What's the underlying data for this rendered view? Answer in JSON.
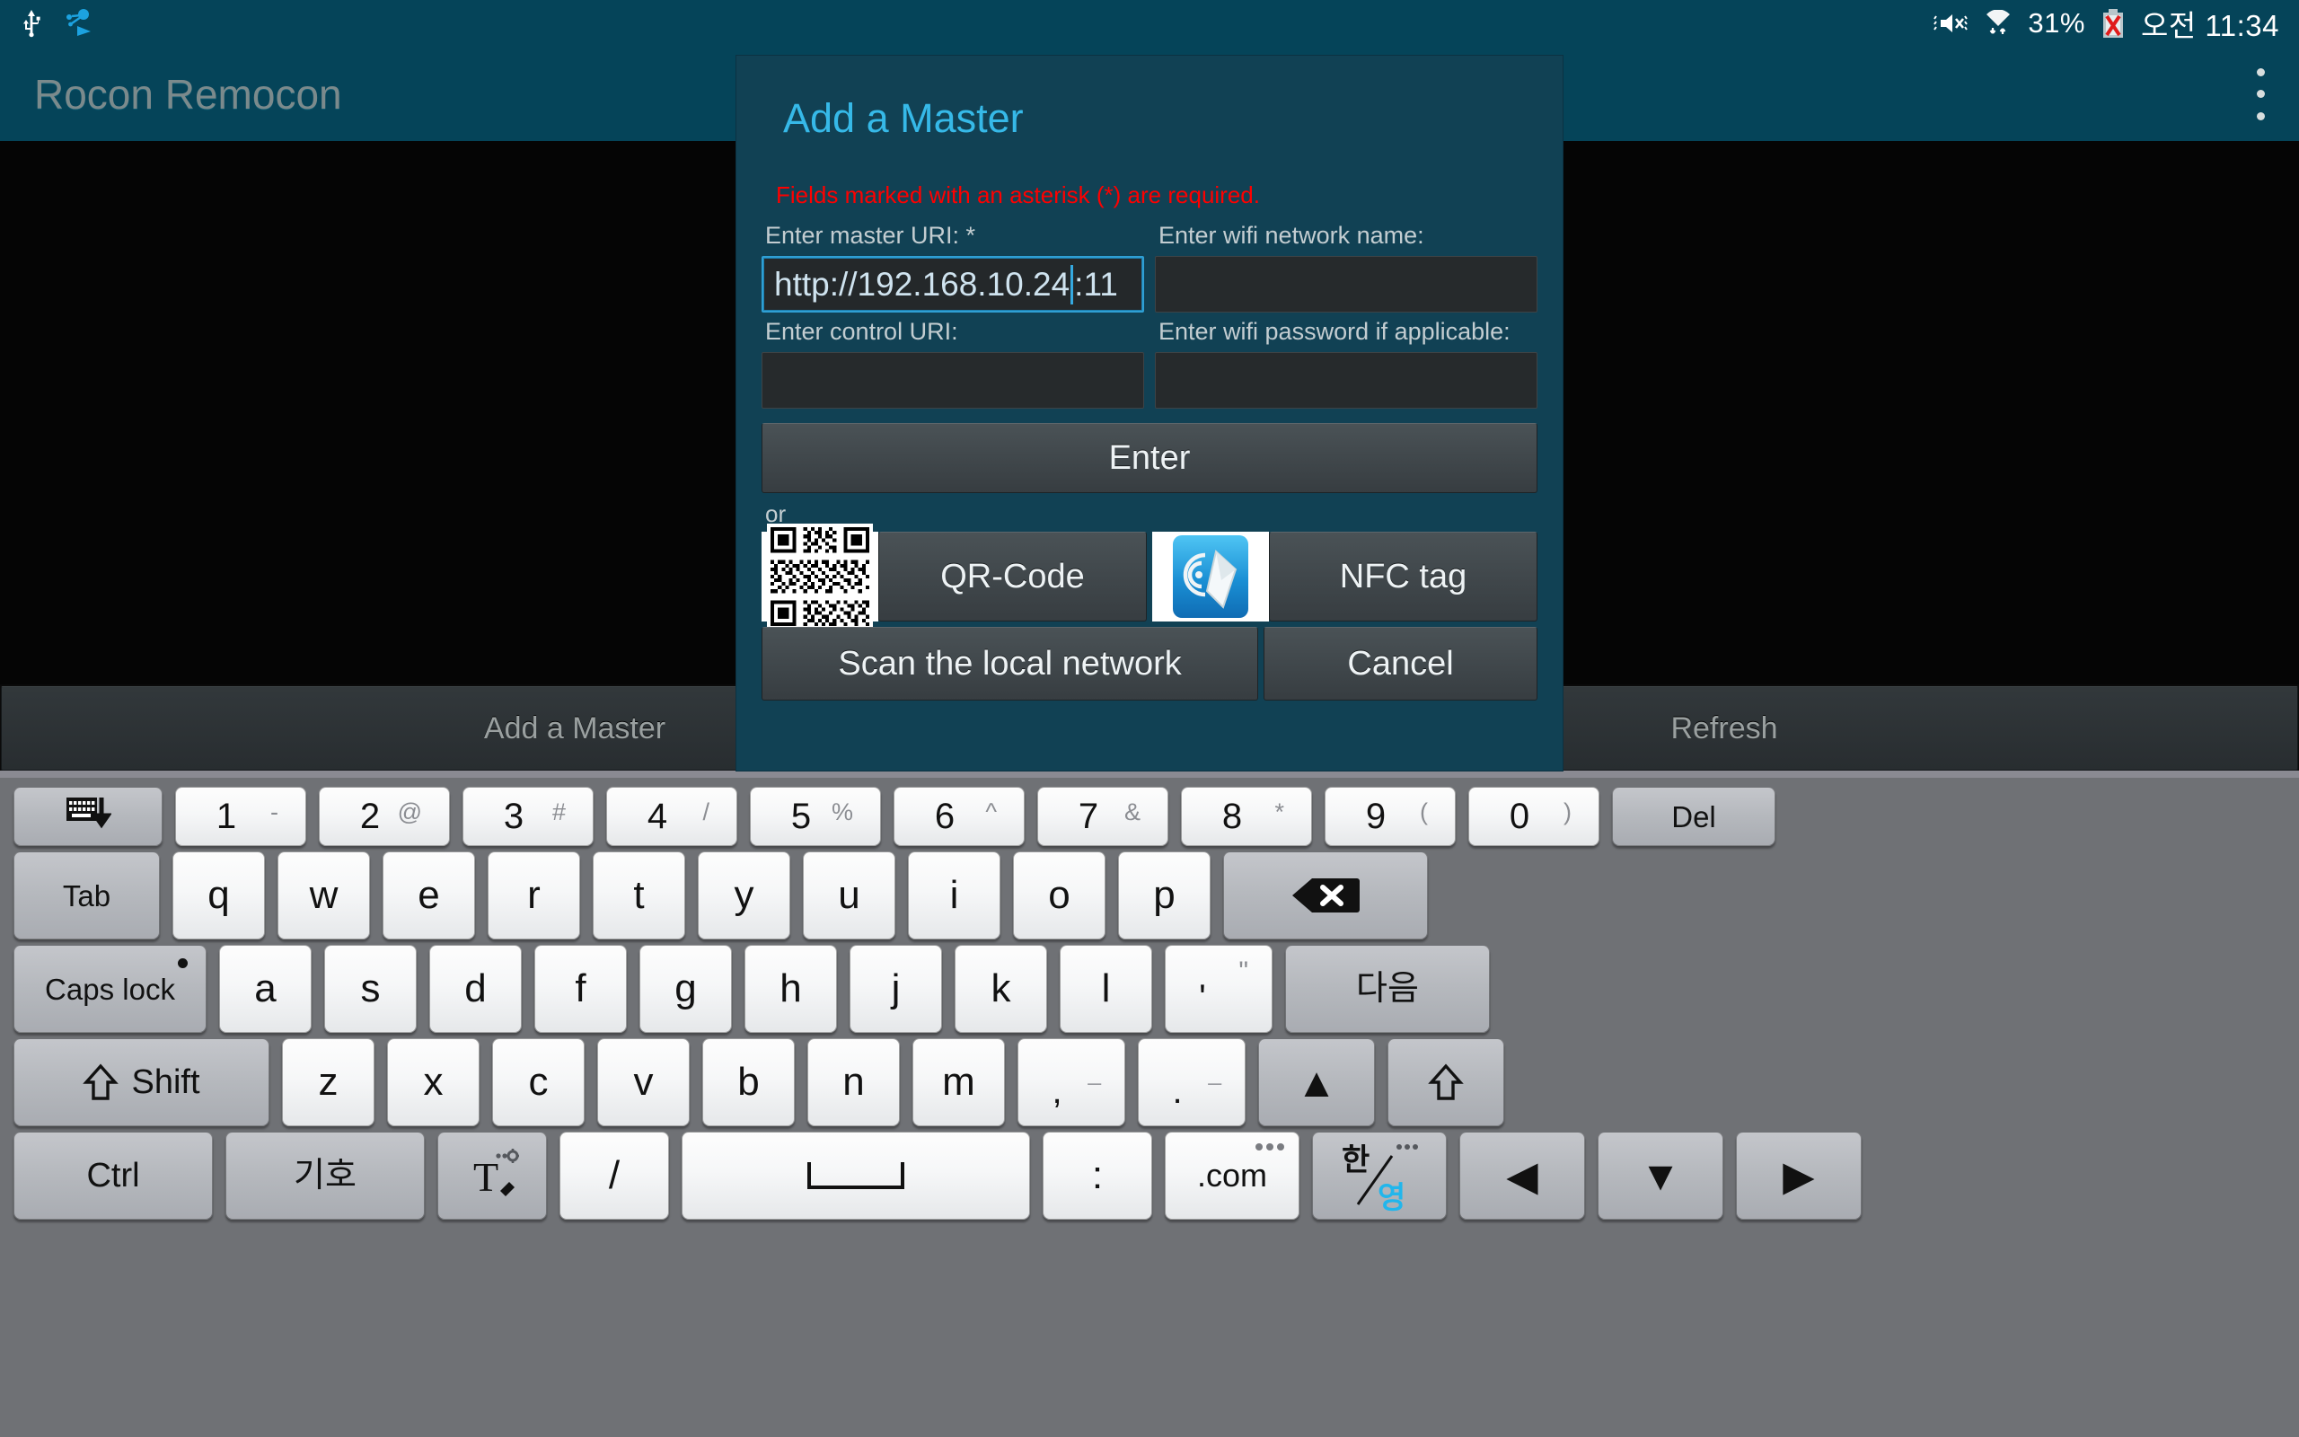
{
  "status_bar": {
    "icons_left": [
      "usb-icon",
      "ros-node-icon"
    ],
    "icons_right": [
      "mute-icon",
      "wifi-icon",
      "battery-error-icon"
    ],
    "battery_percent": "31%",
    "clock": "오전 11:34"
  },
  "app_bar": {
    "title": "Rocon Remocon",
    "overflow_icon": "overflow-menu-icon"
  },
  "action_bar": {
    "buttons": [
      {
        "label": "Add a Master"
      },
      {
        "label": "Refresh"
      }
    ]
  },
  "dialog": {
    "title": "Add a Master",
    "required_note": "Fields marked with an asterisk (*) are required.",
    "fields": {
      "master_uri": {
        "label": "Enter master URI: *",
        "value_before_caret": "http://192.168.10.24",
        "value_after_caret": ":11",
        "focused": true
      },
      "wifi_name": {
        "label": "Enter wifi network name:",
        "value": ""
      },
      "control_uri": {
        "label": "Enter control URI:",
        "value": ""
      },
      "wifi_password": {
        "label": "Enter wifi password if applicable:",
        "value": ""
      }
    },
    "enter_label": "Enter",
    "or_label": "or",
    "qr_label": "QR-Code",
    "qr_icon": "qr-code-icon",
    "nfc_label": "NFC tag",
    "nfc_icon": "nfc-tag-icon",
    "scan_network_label": "Scan the local network",
    "cancel_label": "Cancel",
    "accent_color": "#36b9e8",
    "background_color": "#114154",
    "required_color": "#fe0000"
  },
  "keyboard": {
    "row_num": [
      {
        "name": "hide-keyboard-key",
        "type": "icon",
        "icon": "hide-keyboard-icon",
        "style": "gray"
      },
      {
        "name": "key-1",
        "main": "1",
        "sub": "-",
        "style": "white"
      },
      {
        "name": "key-2",
        "main": "2",
        "sub": "@",
        "style": "white"
      },
      {
        "name": "key-3",
        "main": "3",
        "sub": "#",
        "style": "white"
      },
      {
        "name": "key-4",
        "main": "4",
        "sub": "/",
        "style": "white"
      },
      {
        "name": "key-5",
        "main": "5",
        "sub": "%",
        "style": "white"
      },
      {
        "name": "key-6",
        "main": "6",
        "sub": "^",
        "style": "white"
      },
      {
        "name": "key-7",
        "main": "7",
        "sub": "&",
        "style": "white"
      },
      {
        "name": "key-8",
        "main": "8",
        "sub": "*",
        "style": "white"
      },
      {
        "name": "key-9",
        "main": "9",
        "sub": "(",
        "style": "white"
      },
      {
        "name": "key-0",
        "main": "0",
        "sub": ")",
        "style": "white"
      },
      {
        "name": "key-del",
        "main": "Del",
        "style": "gray"
      }
    ],
    "row_q": [
      {
        "name": "key-tab",
        "main": "Tab",
        "style": "gray"
      },
      {
        "name": "key-q",
        "main": "q",
        "style": "white"
      },
      {
        "name": "key-w",
        "main": "w",
        "style": "white"
      },
      {
        "name": "key-e",
        "main": "e",
        "style": "white"
      },
      {
        "name": "key-r",
        "main": "r",
        "style": "white"
      },
      {
        "name": "key-t",
        "main": "t",
        "style": "white"
      },
      {
        "name": "key-y",
        "main": "y",
        "style": "white"
      },
      {
        "name": "key-u",
        "main": "u",
        "style": "white"
      },
      {
        "name": "key-i",
        "main": "i",
        "style": "white"
      },
      {
        "name": "key-o",
        "main": "o",
        "style": "white"
      },
      {
        "name": "key-p",
        "main": "p",
        "style": "white"
      },
      {
        "name": "key-backspace",
        "type": "icon",
        "icon": "backspace-icon",
        "style": "gray"
      }
    ],
    "row_a": [
      {
        "name": "key-caps-lock",
        "main": "Caps lock",
        "style": "gray"
      },
      {
        "name": "key-a",
        "main": "a",
        "style": "white"
      },
      {
        "name": "key-s",
        "main": "s",
        "style": "white"
      },
      {
        "name": "key-d",
        "main": "d",
        "style": "white"
      },
      {
        "name": "key-f",
        "main": "f",
        "style": "white"
      },
      {
        "name": "key-g",
        "main": "g",
        "style": "white"
      },
      {
        "name": "key-h",
        "main": "h",
        "style": "white"
      },
      {
        "name": "key-j",
        "main": "j",
        "style": "white"
      },
      {
        "name": "key-k",
        "main": "k",
        "style": "white"
      },
      {
        "name": "key-l",
        "main": "l",
        "style": "white"
      },
      {
        "name": "key-apostrophe",
        "main": "'",
        "sub": "\"",
        "style": "white"
      },
      {
        "name": "key-next",
        "main": "다음",
        "style": "gray"
      }
    ],
    "row_z": [
      {
        "name": "key-shift-left",
        "main": "Shift",
        "icon": "shift-arrow-icon",
        "style": "gray"
      },
      {
        "name": "key-z",
        "main": "z",
        "style": "white"
      },
      {
        "name": "key-x",
        "main": "x",
        "style": "white"
      },
      {
        "name": "key-c",
        "main": "c",
        "style": "white"
      },
      {
        "name": "key-v",
        "main": "v",
        "style": "white"
      },
      {
        "name": "key-b",
        "main": "b",
        "style": "white"
      },
      {
        "name": "key-n",
        "main": "n",
        "style": "white"
      },
      {
        "name": "key-m",
        "main": "m",
        "style": "white"
      },
      {
        "name": "key-comma",
        "main": ",",
        "sub": "_",
        "style": "white"
      },
      {
        "name": "key-period",
        "main": ".",
        "sub": "_",
        "style": "white"
      },
      {
        "name": "key-arrow-up",
        "type": "icon",
        "icon": "triangle-up-icon",
        "style": "gray"
      },
      {
        "name": "key-shift-right",
        "type": "icon",
        "icon": "shift-arrow-icon",
        "style": "gray"
      }
    ],
    "row_b": [
      {
        "name": "key-ctrl",
        "main": "Ctrl",
        "style": "gray"
      },
      {
        "name": "key-symbol",
        "main": "기호",
        "style": "gray"
      },
      {
        "name": "key-text-settings",
        "type": "icon",
        "icon": "text-pen-settings-icon",
        "style": "gray"
      },
      {
        "name": "key-slash",
        "main": "/",
        "style": "white"
      },
      {
        "name": "key-space",
        "type": "icon",
        "icon": "spacebar-icon",
        "style": "white"
      },
      {
        "name": "key-colon",
        "main": ":",
        "style": "white"
      },
      {
        "name": "key-dotcom",
        "main": ".com",
        "style": "white"
      },
      {
        "name": "key-language-toggle",
        "type": "icon",
        "icon": "hangul-english-toggle-icon",
        "style": "gray",
        "main_top": "한",
        "main_bottom": "영"
      },
      {
        "name": "key-arrow-left",
        "type": "icon",
        "icon": "triangle-left-icon",
        "style": "gray"
      },
      {
        "name": "key-arrow-down",
        "type": "icon",
        "icon": "triangle-down-icon",
        "style": "gray"
      },
      {
        "name": "key-arrow-right",
        "type": "icon",
        "icon": "triangle-right-icon",
        "style": "gray"
      }
    ]
  }
}
